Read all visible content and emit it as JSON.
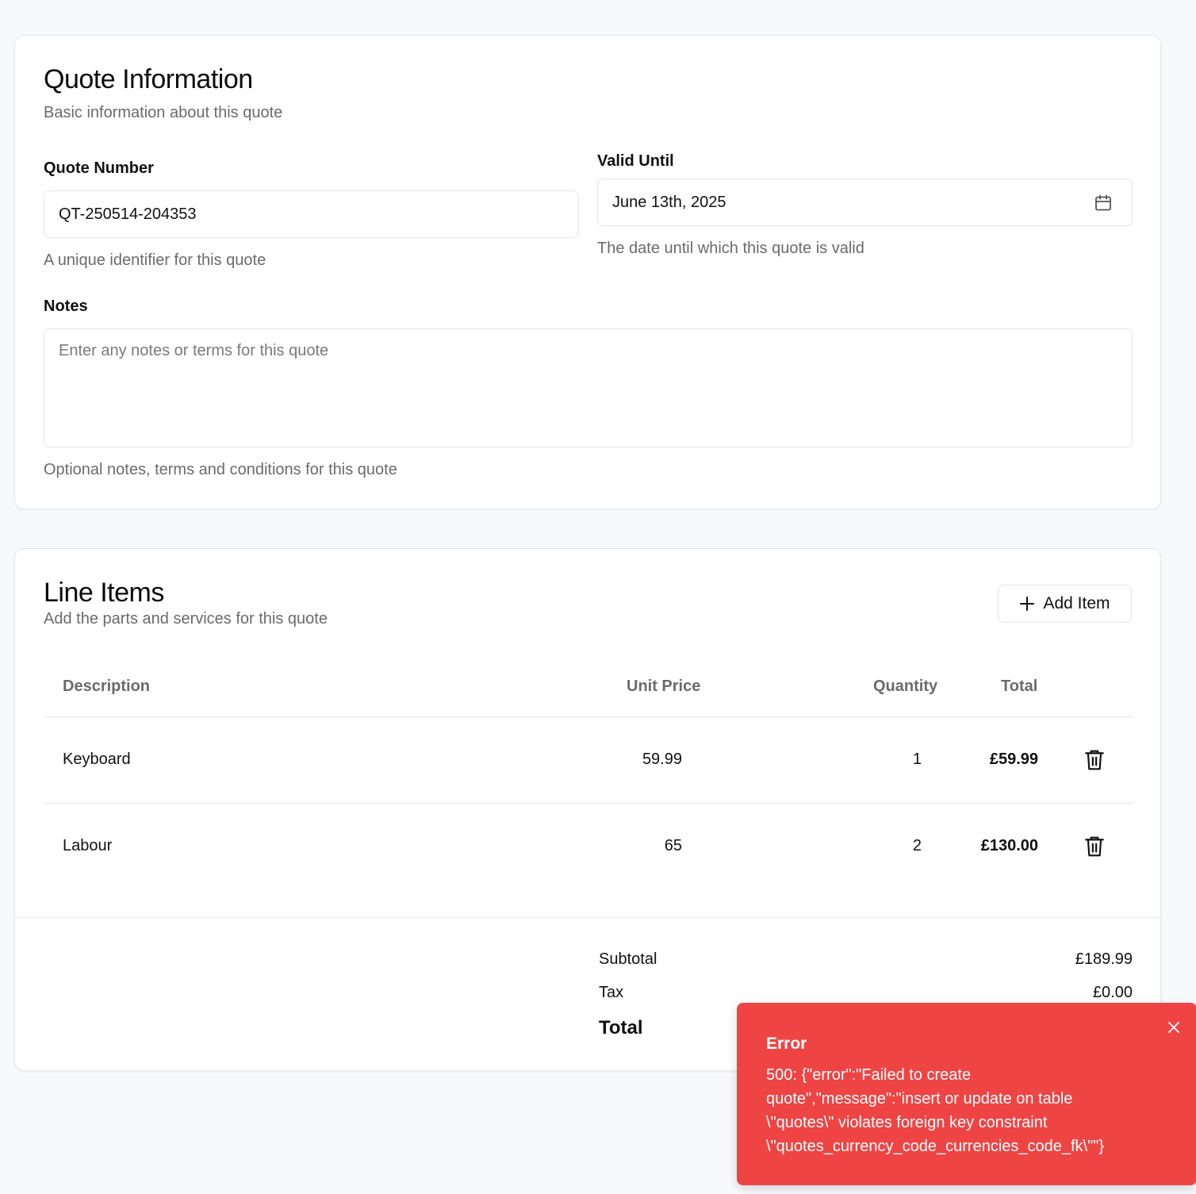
{
  "quote_info": {
    "title": "Quote Information",
    "description": "Basic information about this quote",
    "quote_number": {
      "label": "Quote Number",
      "value": "QT-250514-204353",
      "helper": "A unique identifier for this quote"
    },
    "valid_until": {
      "label": "Valid Until",
      "value": "June 13th, 2025",
      "helper": "The date until which this quote is valid"
    },
    "notes": {
      "label": "Notes",
      "placeholder": "Enter any notes or terms for this quote",
      "helper": "Optional notes, terms and conditions for this quote"
    }
  },
  "line_items": {
    "title": "Line Items",
    "description": "Add the parts and services for this quote",
    "add_label": "Add Item",
    "columns": {
      "description": "Description",
      "unit_price": "Unit Price",
      "quantity": "Quantity",
      "total": "Total"
    },
    "rows": [
      {
        "description": "Keyboard",
        "unit_price": "59.99",
        "quantity": "1",
        "total": "£59.99"
      },
      {
        "description": "Labour",
        "unit_price": "65",
        "quantity": "2",
        "total": "£130.00"
      }
    ]
  },
  "summary": {
    "subtotal_label": "Subtotal",
    "subtotal_value": "£189.99",
    "tax_label": "Tax",
    "tax_value": "£0.00",
    "total_label": "Total"
  },
  "toast": {
    "title": "Error",
    "message": "500: {\"error\":\"Failed to create quote\",\"message\":\"insert or update on table \\\"quotes\\\" violates foreign key constraint \\\"quotes_currency_code_currencies_code_fk\\\"\"}"
  },
  "colors": {
    "error": "#ef4444",
    "muted_text": "#6b6b6b",
    "border": "#e5e7eb"
  },
  "icons": {
    "calendar": "calendar-icon",
    "plus": "plus-icon",
    "trash": "trash-icon",
    "close": "close-icon"
  }
}
